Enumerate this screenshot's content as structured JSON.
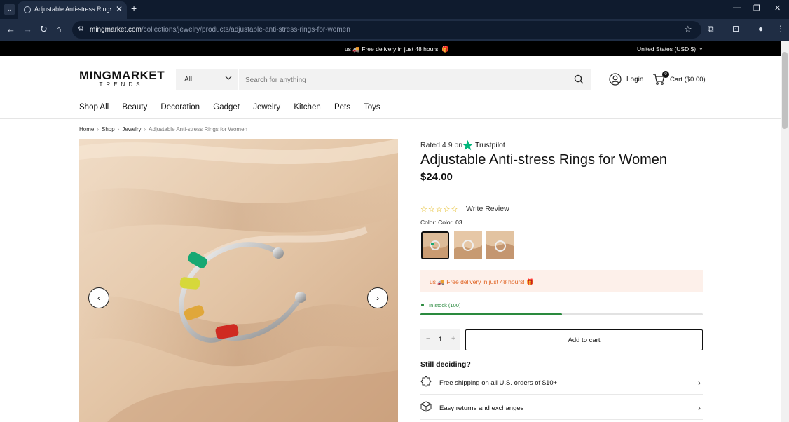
{
  "browser": {
    "tab_title": "Adjustable Anti-stress Rings for Women",
    "url_host": "mingmarket.com",
    "url_path": "/collections/jewelry/products/adjustable-anti-stress-rings-for-women"
  },
  "announcement": {
    "text": "us 🚚 Free delivery in just 48 hours! 🎁",
    "region": "United States (USD $)"
  },
  "header": {
    "logo_main": "MINGMARKET",
    "logo_sub": "TRENDS",
    "search_category": "All",
    "search_placeholder": "Search for anything",
    "login_label": "Login",
    "cart_count": "0",
    "cart_label": "Cart ($0.00)"
  },
  "nav": {
    "items": [
      "Shop All",
      "Beauty",
      "Decoration",
      "Gadget",
      "Jewelry",
      "Kitchen",
      "Pets",
      "Toys"
    ]
  },
  "breadcrumb": {
    "items": [
      "Home",
      "Shop",
      "Jewelry",
      "Adjustable Anti-stress Rings for Women"
    ]
  },
  "product": {
    "rated_text": "Rated 4.9 on",
    "rating_provider": "Trustpilot",
    "title": "Adjustable Anti-stress Rings for Women",
    "price": "$24.00",
    "stars_text": "☆☆☆☆☆",
    "write_review": "Write Review",
    "color_label": "Color:",
    "color_value": "Color: 03",
    "delivery_text": "us 🚚 Free delivery in just 48 hours! 🎁",
    "stock_text": "In stock (100)",
    "stock_fraction": 0.5,
    "quantity": "1",
    "qty_minus": "−",
    "qty_plus": "+",
    "add_to_cart": "Add to cart",
    "still_deciding": "Still deciding?",
    "perks": [
      {
        "icon": "badge-icon",
        "text": "Free shipping on all U.S. orders of $10+"
      },
      {
        "icon": "box-icon",
        "text": "Easy returns and exchanges"
      }
    ]
  },
  "colors": {
    "accent_orange": "#e06424",
    "stock_green": "#2a8a3e",
    "trustpilot_green": "#00b67a"
  }
}
